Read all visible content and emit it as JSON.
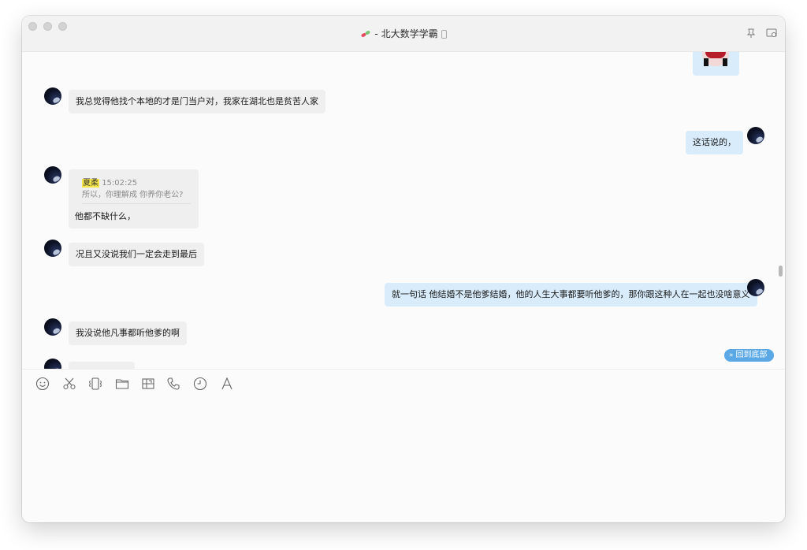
{
  "window": {
    "title": "- 北大数学学霸"
  },
  "messages": {
    "m1": "我总觉得他找个本地的才是门当户对，我家在湖北也是贫苦人家",
    "m2": "这话说的，",
    "m3_quote_name": "夏柔",
    "m3_quote_time": "15:02:25",
    "m3_quote_text": "所以，你理解成 你养你老公?",
    "m3": "他都不缺什么，",
    "m4": "况且又没说我们一定会走到最后",
    "m5": "就一句话 他结婚不是他爹结婚，他的人生大事都要听他爹的，那你跟这种人在一起也没啥意义",
    "m6": "我没说他凡事都听他爹的啊"
  },
  "back_to_bottom": "回到底部",
  "toolbar": {
    "icons": [
      "emoji-icon",
      "scissors-icon",
      "vibrate-icon",
      "folder-icon",
      "screenshot-icon",
      "phone-icon",
      "clock-icon",
      "font-icon"
    ]
  },
  "colors": {
    "incoming_bubble": "#efefef",
    "outgoing_bubble": "#d9ecfb",
    "accent": "#5aa8e6",
    "quote_highlight": "#f7e64a"
  }
}
